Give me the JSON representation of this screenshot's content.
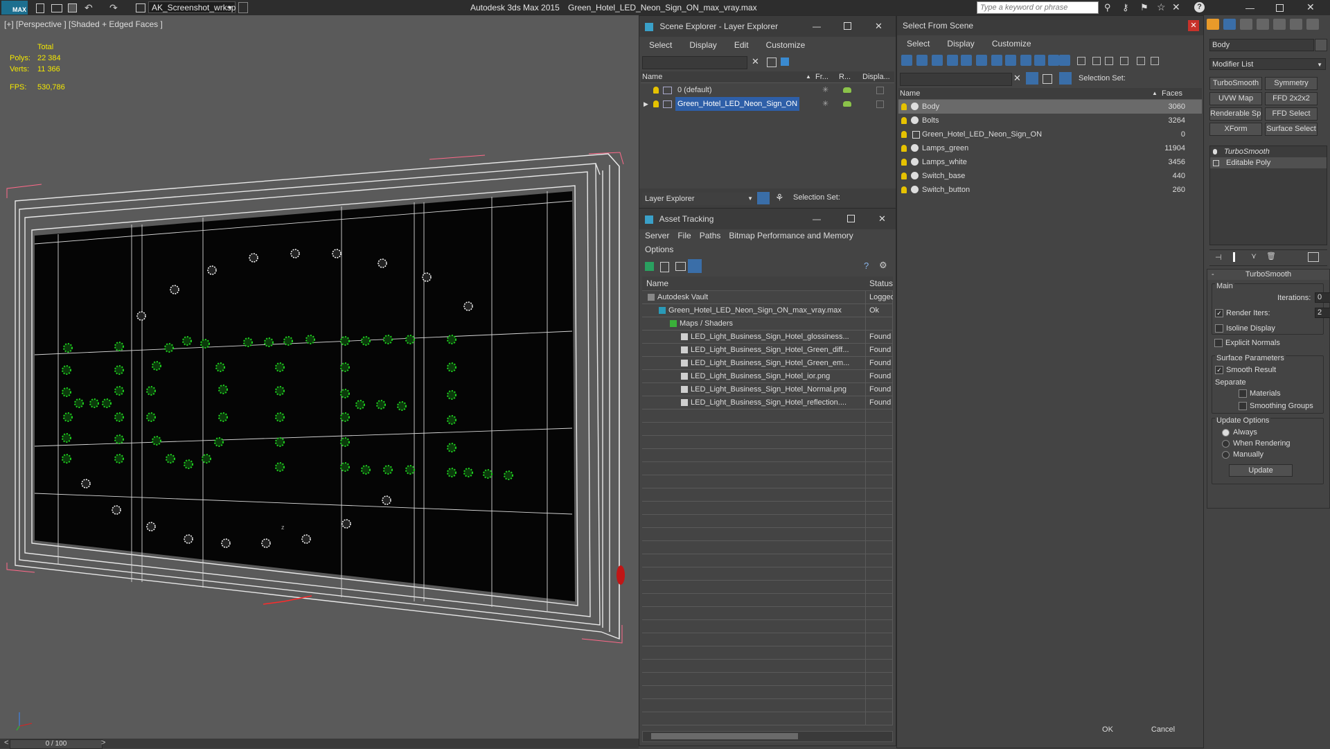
{
  "titlebar": {
    "app_logo": "MAX",
    "workspace": "AK_Screenshot_wrksp",
    "app_title": "Autodesk 3ds Max  2015",
    "file_title": "Green_Hotel_LED_Neon_Sign_ON_max_vray.max",
    "search_placeholder": "Type a keyword or phrase"
  },
  "viewport": {
    "label": "[+] [Perspective ] [Shaded + Edged Faces ]",
    "stats_total_label": "Total",
    "polys_label": "Polys:",
    "polys_value": "22 384",
    "verts_label": "Verts:",
    "verts_value": "11 366",
    "fps_label": "FPS:",
    "fps_value": "530,786",
    "time_slider": "0 / 100",
    "axis_z": "z"
  },
  "layer_explorer": {
    "title": "Scene Explorer - Layer Explorer",
    "menu": [
      "Select",
      "Display",
      "Edit",
      "Customize"
    ],
    "columns": [
      "Name",
      "Fr...",
      "R...",
      "Displa..."
    ],
    "layers": [
      {
        "name": "0 (default)",
        "selected": false
      },
      {
        "name": "Green_Hotel_LED_Neon_Sign_ON",
        "selected": true
      }
    ],
    "footer_dropdown": "Layer Explorer",
    "selection_set_label": "Selection Set:"
  },
  "asset_tracking": {
    "title": "Asset Tracking",
    "menu": [
      "Server",
      "File",
      "Paths",
      "Bitmap Performance and Memory"
    ],
    "menu2": "Options",
    "columns": [
      "Name",
      "Status"
    ],
    "rows": [
      {
        "name": "Autodesk Vault",
        "status": "Logged",
        "indent": 1
      },
      {
        "name": "Green_Hotel_LED_Neon_Sign_ON_max_vray.max",
        "status": "Ok",
        "indent": 2
      },
      {
        "name": "Maps / Shaders",
        "status": "",
        "indent": 3
      },
      {
        "name": "LED_Light_Business_Sign_Hotel_glossiness...",
        "status": "Found",
        "indent": 4
      },
      {
        "name": "LED_Light_Business_Sign_Hotel_Green_diff...",
        "status": "Found",
        "indent": 4
      },
      {
        "name": "LED_Light_Business_Sign_Hotel_Green_em...",
        "status": "Found",
        "indent": 4
      },
      {
        "name": "LED_Light_Business_Sign_Hotel_ior.png",
        "status": "Found",
        "indent": 4
      },
      {
        "name": "LED_Light_Business_Sign_Hotel_Normal.png",
        "status": "Found",
        "indent": 4
      },
      {
        "name": "LED_Light_Business_Sign_Hotel_reflection....",
        "status": "Found",
        "indent": 4
      }
    ]
  },
  "select_from_scene": {
    "title": "Select From Scene",
    "menu": [
      "Select",
      "Display",
      "Customize"
    ],
    "selection_set_label": "Selection Set:",
    "columns": [
      "Name",
      "Faces"
    ],
    "objects": [
      {
        "name": "Body",
        "faces": "3060",
        "selected": true
      },
      {
        "name": "Bolts",
        "faces": "3264",
        "selected": false
      },
      {
        "name": "Green_Hotel_LED_Neon_Sign_ON",
        "faces": "0",
        "selected": false
      },
      {
        "name": "Lamps_green",
        "faces": "11904",
        "selected": false
      },
      {
        "name": "Lamps_white",
        "faces": "3456",
        "selected": false
      },
      {
        "name": "Switch_base",
        "faces": "440",
        "selected": false
      },
      {
        "name": "Switch_button",
        "faces": "260",
        "selected": false
      }
    ],
    "ok_label": "OK",
    "cancel_label": "Cancel"
  },
  "command_panel": {
    "object_name": "Body",
    "modifier_list_label": "Modifier List",
    "modifier_buttons": [
      "TurboSmooth",
      "Symmetry",
      "UVW Map",
      "FFD 2x2x2",
      "Renderable Spline",
      "FFD Select",
      "XForm",
      "Surface Select"
    ],
    "stack": [
      "TurboSmooth",
      "Editable Poly"
    ],
    "rollout_title": "TurboSmooth",
    "main_label": "Main",
    "iterations_label": "Iterations:",
    "iterations_value": "0",
    "render_iters_label": "Render Iters:",
    "render_iters_value": "2",
    "isoline_label": "Isoline Display",
    "explicit_normals_label": "Explicit Normals",
    "surface_params_label": "Surface Parameters",
    "smooth_result_label": "Smooth Result",
    "separate_label": "Separate",
    "materials_label": "Materials",
    "smoothing_groups_label": "Smoothing Groups",
    "update_options_label": "Update Options",
    "always_label": "Always",
    "when_rendering_label": "When Rendering",
    "manually_label": "Manually",
    "update_button": "Update"
  },
  "colors": {
    "selection": "#2e5fa8",
    "stats_text": "#f4e800",
    "led_green": "#1fd01f",
    "wire": "#ffffff",
    "bbox": "#ff6a8a"
  }
}
